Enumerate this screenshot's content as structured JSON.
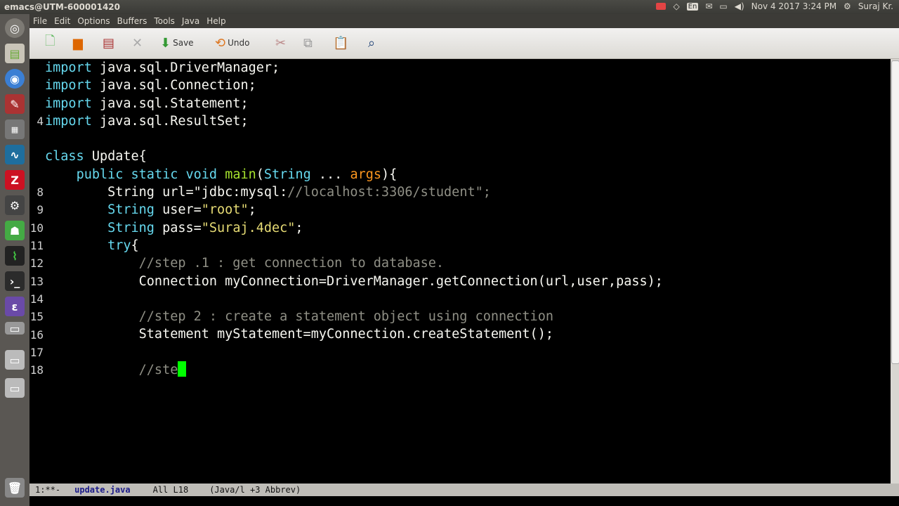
{
  "window_title": "emacs@UTM-600001420",
  "tray": {
    "keyboard": "En",
    "datetime": "Nov 4 2017  3:24 PM",
    "user": "Suraj Kr."
  },
  "menu": [
    "File",
    "Edit",
    "Options",
    "Buffers",
    "Tools",
    "Java",
    "Help"
  ],
  "toolbar": {
    "save_label": "Save",
    "undo_label": "Undo",
    "icons": [
      "new-file-icon",
      "open-folder-icon",
      "dired-icon",
      "close-icon",
      "save-icon",
      "undo-icon",
      "cut-icon",
      "copy-icon",
      "paste-icon",
      "search-icon"
    ]
  },
  "launcher": [
    "dash-icon",
    "files-icon",
    "chromium-icon",
    "tools-icon",
    "keyboard-icon",
    "matlab-icon",
    "filezilla-icon",
    "settings-icon",
    "android-icon",
    "monitor-icon",
    "terminal-icon",
    "emacs-icon",
    "drive-icon",
    "disk-icon",
    "disk2-icon",
    "trash-icon"
  ],
  "line_numbers": [
    "",
    "",
    "",
    "4",
    "",
    "",
    "",
    "8",
    "9",
    "10",
    "11",
    "12",
    "13",
    "14",
    "15",
    "16",
    "17",
    "18"
  ],
  "code_lines": [
    "import java.sql.DriverManager;",
    "import java.sql.Connection;",
    "import java.sql.Statement;",
    "import java.sql.ResultSet;",
    "",
    "class Update{",
    "    public static void main(String ... args){",
    "        String url=\"jdbc:mysql://localhost:3306/student\";",
    "        String user=\"root\";",
    "        String pass=\"Suraj.4dec\";",
    "        try{",
    "            //step .1 : get connection to database.",
    "            Connection myConnection=DriverManager.getConnection(url,user,pass);",
    "",
    "            //step 2 : create a statement object using connection",
    "            Statement myStatement=myConnection.createStatement();",
    "",
    "            //ste"
  ],
  "modeline": {
    "status": "1:**-",
    "buffer": "update.java",
    "position": "All L18",
    "modes": "(Java/l +3 Abbrev)"
  },
  "colors": {
    "keyword": "#66d9ef",
    "string": "#e6db74",
    "comment": "#8f8f85",
    "cursor": "#00ff00",
    "background": "#000000"
  }
}
